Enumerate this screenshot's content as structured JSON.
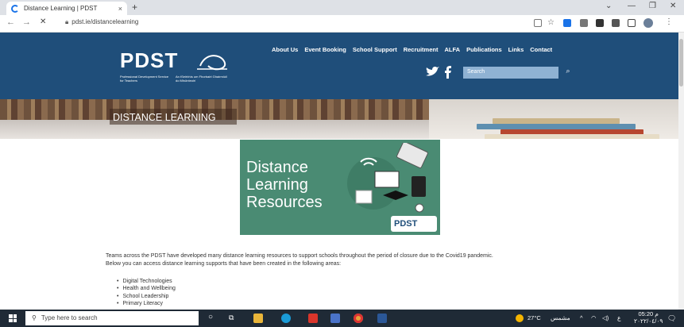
{
  "browser": {
    "tab_title": "Distance Learning | PDST",
    "tab_close": "×",
    "new_tab": "+",
    "url": "pdst.ie/distancelearning"
  },
  "site": {
    "logo_word": "PDST",
    "logo_sub_en": "Professional Development Service for Teachers",
    "logo_sub_ga": "An tSeirbhís um Fhorbairt Ghairmiúil do Mhúinteoirí",
    "nav": [
      "About Us",
      "Event Booking",
      "School Support",
      "Recruitment",
      "ALFA",
      "Publications",
      "Links",
      "Contact"
    ],
    "search_placeholder": "Search",
    "banner_title": "DISTANCE LEARNING"
  },
  "hero": {
    "line1": "Distance",
    "line2": "Learning",
    "line3": "Resources",
    "badge": "PDST"
  },
  "content": {
    "intro_line1": "Teams across the  PDST have developed many distance learning resources to support schools throughout the period of closure due to the Covid19 pandemic.",
    "intro_line2": "Below you can access distance learning supports that have been created in the following areas:",
    "areas": [
      "Digital Technologies",
      "Health and Wellbeing",
      "School Leadership",
      "Primary Literacy"
    ]
  },
  "taskbar": {
    "search_placeholder": "Type here to search",
    "weather": "27°C",
    "weather_desc": "مشمس",
    "lang": "ع",
    "time": "05:20 م",
    "date": "٢٠٢٢/٠٤/٠٩"
  },
  "colors": {
    "header_bg": "#1f4e7a",
    "hero_bg": "#4a8b73",
    "taskbar_bg": "#1f2a36"
  }
}
